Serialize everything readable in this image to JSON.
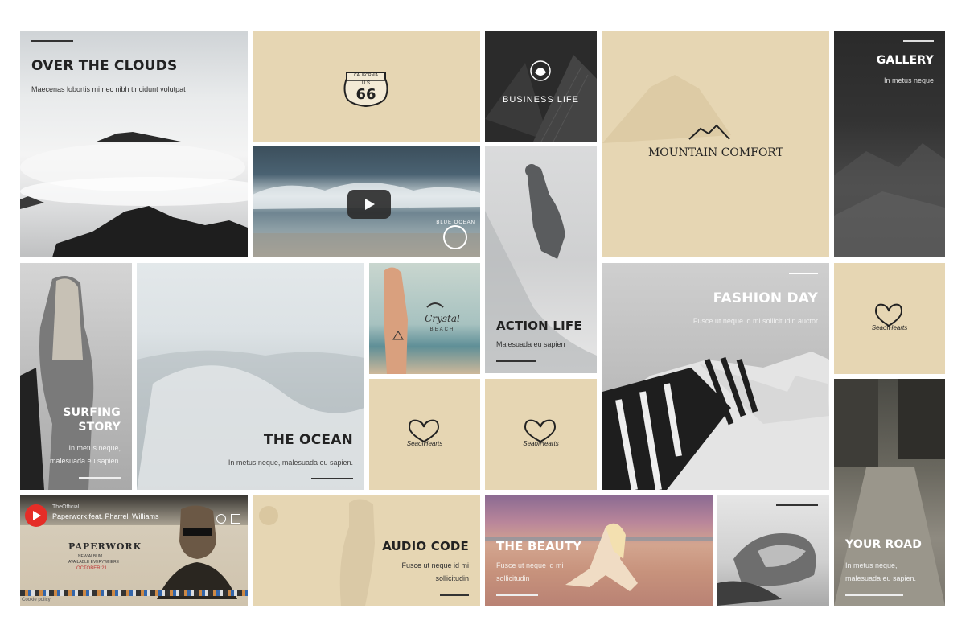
{
  "tiles": {
    "clouds": {
      "title": "OVER THE CLOUDS",
      "sub": "Maecenas lobortis mi nec nibh tincidunt volutpat"
    },
    "route66": {
      "sign_top": "CALIFORNIA",
      "sign_mid": "U S",
      "sign_num": "66"
    },
    "business": {
      "label": "BUSINESS LIFE"
    },
    "mountain": {
      "label": "MOUNTAIN COMFORT"
    },
    "gallery": {
      "title": "GALLERY",
      "sub": "In metus neque"
    },
    "blue_ocean": {
      "logo": "BLUE OCEAN"
    },
    "action": {
      "title": "ACTION LIFE",
      "sub": "Malesuada eu sapien"
    },
    "surfing": {
      "title_1": "SURFING",
      "title_2": "STORY",
      "sub_1": "In metus neque,",
      "sub_2": "malesuada eu sapien."
    },
    "the_ocean": {
      "title": "THE OCEAN",
      "sub": "In metus neque, malesuada eu sapien."
    },
    "crystal": {
      "logo_1": "Crystal",
      "logo_2": "BEACH"
    },
    "seaofhearts": {
      "label": "SeaofHearts"
    },
    "fashion": {
      "title": "FASHION DAY",
      "sub": "Fusce ut neque id mi sollicitudin auctor"
    },
    "video": {
      "channel": "TheOfficial",
      "video_title": "Paperwork feat. Pharrell Williams",
      "poster_1": "PAPERWORK",
      "poster_2": "NEW ALBUM",
      "poster_3": "AVAILABLE EVERYWHERE",
      "poster_4": "OCTOBER 21",
      "footer": "Cookie policy"
    },
    "audio": {
      "title": "AUDIO CODE",
      "sub_1": "Fusce ut neque id mi",
      "sub_2": "sollicitudin"
    },
    "beauty": {
      "title": "THE BEAUTY",
      "sub_1": "Fusce ut neque id mi",
      "sub_2": "sollicitudin"
    },
    "road": {
      "title": "YOUR ROAD",
      "sub_1": "In metus neque,",
      "sub_2": "malesuada eu sapien."
    }
  },
  "colors": {
    "beige": "#e6d6b3",
    "dark_tile": "#2e2e2e",
    "accent_red": "#e52d27"
  }
}
